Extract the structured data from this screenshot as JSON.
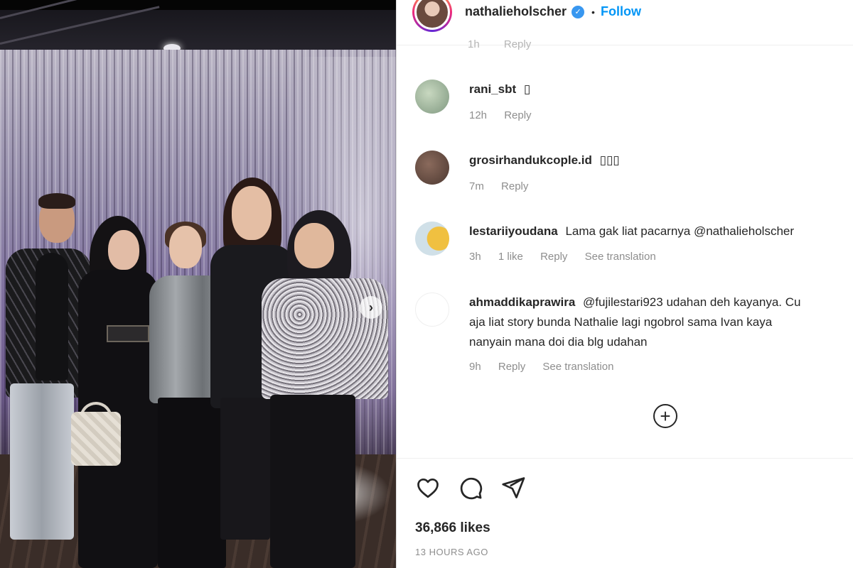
{
  "post": {
    "username": "nathalieholscher",
    "verified_icon": "verified-badge-icon",
    "follow_label": "Follow",
    "separator": "•",
    "likes_text": "36,866 likes",
    "time_ago": "13 HOURS AGO"
  },
  "faded_row": {
    "time": "1h",
    "reply": "Reply"
  },
  "comments": [
    {
      "username": "rani_sbt",
      "text": "▯",
      "time": "12h",
      "likes": "",
      "reply": "Reply",
      "translate": ""
    },
    {
      "username": "grosirhandukcople.id",
      "text": "▯▯▯",
      "time": "7m",
      "likes": "",
      "reply": "Reply",
      "translate": ""
    },
    {
      "username": "lestariiyoudana",
      "text": "Lama gak liat pacarnya @nathalieholscher",
      "time": "3h",
      "likes": "1 like",
      "reply": "Reply",
      "translate": "See translation"
    },
    {
      "username": "ahmaddikaprawira",
      "text_lines": [
        "@fujilestari923 udahan deh kayanya. Cu",
        "aja liat story bunda Nathalie lagi ngobrol sama Ivan kaya",
        "nanyain mana doi dia blg udahan"
      ],
      "time": "9h",
      "likes": "",
      "reply": "Reply",
      "translate": "See translation"
    }
  ],
  "icons": {
    "like": "heart-icon",
    "comment": "comment-icon",
    "share": "paper-plane-icon",
    "load_more": "plus-circle-icon",
    "carousel_next": "chevron-right-icon"
  },
  "glyphs": {
    "load_more": "+",
    "carousel_next": "›",
    "verified": "✓"
  }
}
